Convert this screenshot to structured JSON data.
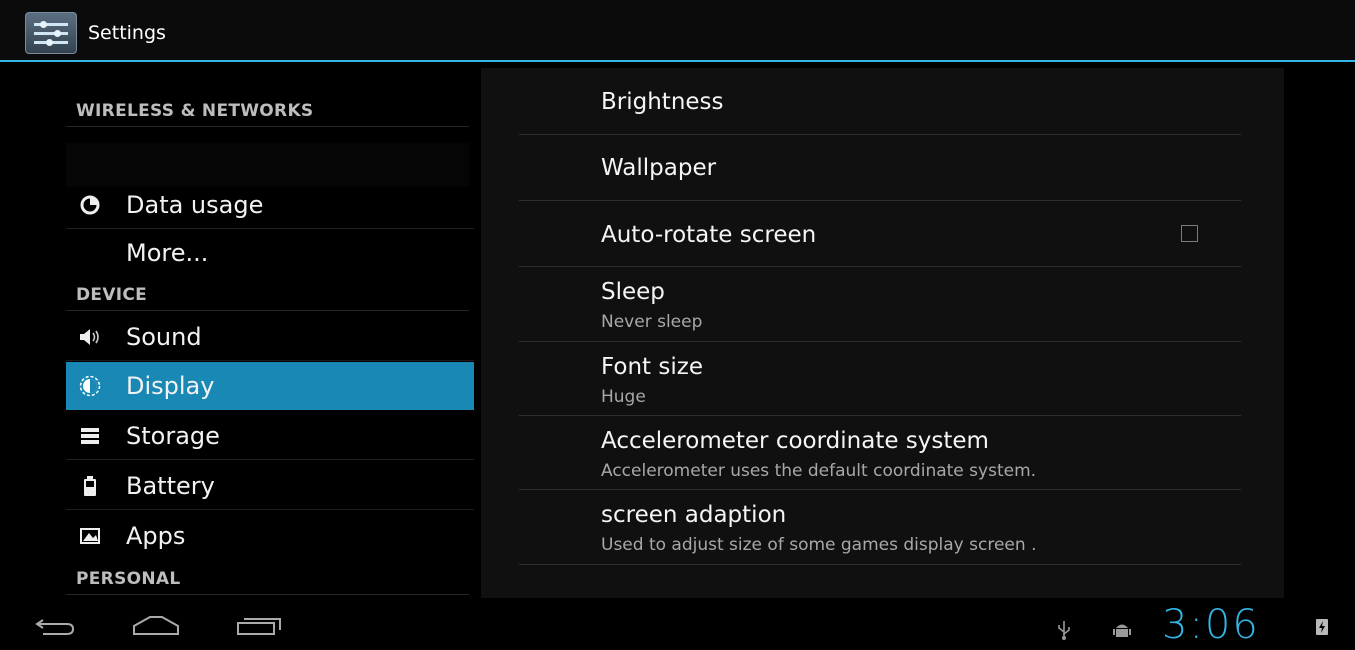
{
  "actionbar": {
    "title": "Settings",
    "icon": "settings-sliders-icon"
  },
  "sidebar": {
    "headers": {
      "wireless": "WIRELESS & NETWORKS",
      "device": "DEVICE",
      "personal": "PERSONAL"
    },
    "items": [
      {
        "label": "Data usage",
        "icon": "data-usage-icon"
      },
      {
        "label": "More...",
        "icon": ""
      },
      {
        "label": "Sound",
        "icon": "speaker-icon"
      },
      {
        "label": "Display",
        "icon": "display-brightness-icon",
        "selected": true
      },
      {
        "label": "Storage",
        "icon": "storage-icon"
      },
      {
        "label": "Battery",
        "icon": "battery-icon"
      },
      {
        "label": "Apps",
        "icon": "apps-icon"
      }
    ]
  },
  "display": {
    "items": [
      {
        "title": "Brightness"
      },
      {
        "title": "Wallpaper"
      },
      {
        "title": "Auto-rotate screen",
        "checked": false
      },
      {
        "title": "Sleep",
        "summary": "Never sleep"
      },
      {
        "title": "Font size",
        "summary": "Huge"
      },
      {
        "title": "Accelerometer coordinate system",
        "summary": "Accelerometer uses the default coordinate system."
      },
      {
        "title": "screen adaption",
        "summary": "Used to adjust size of some games display screen ."
      }
    ]
  },
  "navbar": {
    "back_icon": "back-icon",
    "home_icon": "home-icon",
    "recents_icon": "recent-apps-icon",
    "usb_icon": "usb-icon",
    "debug_icon": "android-debug-icon",
    "clock": "3:06",
    "battery_icon": "battery-charging-icon"
  },
  "colors": {
    "accent": "#33b5e5",
    "selected_bg": "#1a88b5",
    "background": "#000000"
  }
}
